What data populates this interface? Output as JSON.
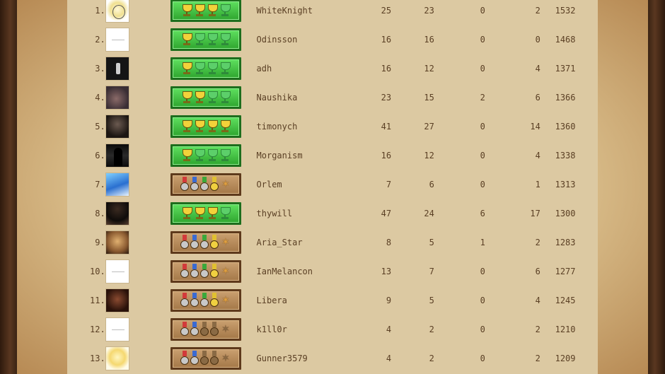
{
  "leaderboard": {
    "rows": [
      {
        "rank": "1.",
        "avatar": "av-sketch",
        "award": {
          "type": "trophies",
          "lit": 3
        },
        "name": "WhiteKnight",
        "c1": "25",
        "c2": "23",
        "c3": "0",
        "c4": "2",
        "rating": "1532"
      },
      {
        "rank": "2.",
        "avatar": "av-blank",
        "award": {
          "type": "trophies",
          "lit": 1
        },
        "name": "Odinsson",
        "c1": "16",
        "c2": "16",
        "c3": "0",
        "c4": "0",
        "rating": "1468"
      },
      {
        "rank": "3.",
        "avatar": "av-bottle",
        "award": {
          "type": "trophies",
          "lit": 1
        },
        "name": "adh",
        "c1": "16",
        "c2": "12",
        "c3": "0",
        "c4": "4",
        "rating": "1371"
      },
      {
        "rank": "4.",
        "avatar": "av-room",
        "award": {
          "type": "trophies",
          "lit": 2
        },
        "name": "Naushika",
        "c1": "23",
        "c2": "15",
        "c3": "2",
        "c4": "6",
        "rating": "1366"
      },
      {
        "rank": "5.",
        "avatar": "av-dark",
        "award": {
          "type": "trophies",
          "lit": 4
        },
        "name": "timonych",
        "c1": "41",
        "c2": "27",
        "c3": "0",
        "c4": "14",
        "rating": "1360"
      },
      {
        "rank": "6.",
        "avatar": "av-shadow",
        "award": {
          "type": "trophies",
          "lit": 1
        },
        "name": "Morganism",
        "c1": "16",
        "c2": "12",
        "c3": "0",
        "c4": "4",
        "rating": "1338"
      },
      {
        "rank": "7.",
        "avatar": "av-anime",
        "award": {
          "type": "medals",
          "lit": 5
        },
        "name": "Orlem",
        "c1": "7",
        "c2": "6",
        "c3": "0",
        "c4": "1",
        "rating": "1313"
      },
      {
        "rank": "8.",
        "avatar": "av-hat",
        "award": {
          "type": "trophies",
          "lit": 3
        },
        "name": "thywill",
        "c1": "47",
        "c2": "24",
        "c3": "6",
        "c4": "17",
        "rating": "1300"
      },
      {
        "rank": "9.",
        "avatar": "av-elf",
        "award": {
          "type": "medals",
          "lit": 5
        },
        "name": "Aria_Star",
        "c1": "8",
        "c2": "5",
        "c3": "1",
        "c4": "2",
        "rating": "1283"
      },
      {
        "rank": "10.",
        "avatar": "av-blank",
        "award": {
          "type": "medals",
          "lit": 5
        },
        "name": "IanMelancon",
        "c1": "13",
        "c2": "7",
        "c3": "0",
        "c4": "6",
        "rating": "1277"
      },
      {
        "rank": "11.",
        "avatar": "av-face",
        "award": {
          "type": "medals",
          "lit": 5
        },
        "name": "Libera",
        "c1": "9",
        "c2": "5",
        "c3": "0",
        "c4": "4",
        "rating": "1245"
      },
      {
        "rank": "12.",
        "avatar": "av-blank",
        "award": {
          "type": "medals",
          "lit": 2
        },
        "name": "k1ll0r",
        "c1": "4",
        "c2": "2",
        "c3": "0",
        "c4": "2",
        "rating": "1210"
      },
      {
        "rank": "13.",
        "avatar": "av-blonde",
        "award": {
          "type": "medals",
          "lit": 2
        },
        "name": "Gunner3579",
        "c1": "4",
        "c2": "2",
        "c3": "0",
        "c4": "2",
        "rating": "1209"
      }
    ]
  },
  "medal_colors": [
    "#d23a3a",
    "#3a6ad2",
    "#3aa83a",
    "#e0c030",
    "#8a3ad2"
  ]
}
